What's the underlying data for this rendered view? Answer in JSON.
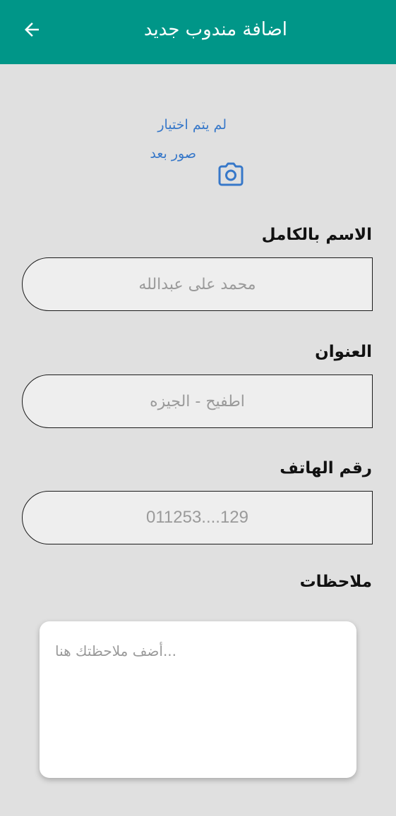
{
  "appbar": {
    "title": "اضافة مندوب جديد",
    "background": "#009688",
    "back_icon": "arrow-back-icon"
  },
  "photo": {
    "status_line1": "لم يتم اختيار",
    "status_line2": "صور بعد",
    "text_color": "#3778c9",
    "icon": "camera-icon"
  },
  "form": {
    "name": {
      "label": "الاسم بالكامل",
      "placeholder": "محمد على عبدالله",
      "value": ""
    },
    "address": {
      "label": "العنوان",
      "placeholder": "اطفيح - الجيزه",
      "value": ""
    },
    "phone": {
      "label": "رقم الهاتف",
      "placeholder": "011253....129",
      "value": ""
    },
    "notes": {
      "label": "ملاحظات",
      "placeholder": "...أضف ملاحظتك هنا",
      "value": ""
    }
  }
}
